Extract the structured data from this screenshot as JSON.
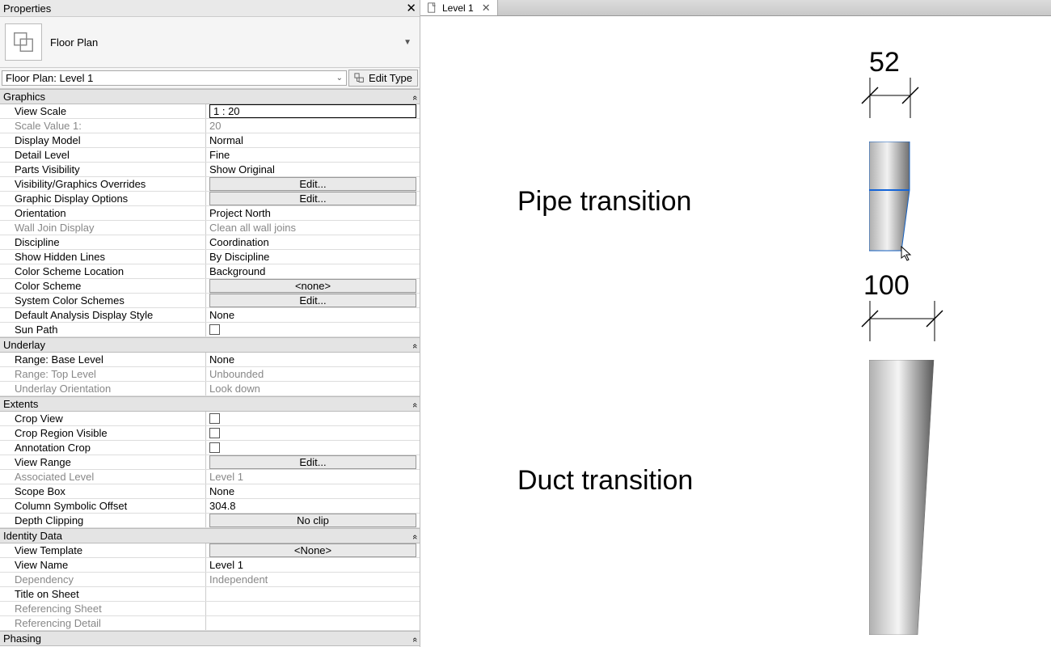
{
  "panel": {
    "title": "Properties",
    "close": "✕",
    "type_name": "Floor Plan",
    "instance_name": "Floor Plan: Level 1",
    "edit_type": "Edit Type"
  },
  "groups": [
    {
      "name": "Graphics",
      "rows": [
        {
          "n": "View Scale",
          "v": "1 : 20",
          "kind": "boxed"
        },
        {
          "n": "Scale Value    1:",
          "v": "20",
          "disabled": true
        },
        {
          "n": "Display Model",
          "v": "Normal"
        },
        {
          "n": "Detail Level",
          "v": "Fine"
        },
        {
          "n": "Parts Visibility",
          "v": "Show Original"
        },
        {
          "n": "Visibility/Graphics Overrides",
          "v": "Edit...",
          "kind": "btn"
        },
        {
          "n": "Graphic Display Options",
          "v": "Edit...",
          "kind": "btn"
        },
        {
          "n": "Orientation",
          "v": "Project North"
        },
        {
          "n": "Wall Join Display",
          "v": "Clean all wall joins",
          "disabled": true
        },
        {
          "n": "Discipline",
          "v": "Coordination"
        },
        {
          "n": "Show Hidden Lines",
          "v": "By Discipline"
        },
        {
          "n": "Color Scheme Location",
          "v": "Background"
        },
        {
          "n": "Color Scheme",
          "v": "<none>",
          "kind": "btn"
        },
        {
          "n": "System Color Schemes",
          "v": "Edit...",
          "kind": "btn"
        },
        {
          "n": "Default Analysis Display Style",
          "v": "None"
        },
        {
          "n": "Sun Path",
          "v": "",
          "kind": "check"
        }
      ]
    },
    {
      "name": "Underlay",
      "rows": [
        {
          "n": "Range: Base Level",
          "v": "None"
        },
        {
          "n": "Range: Top Level",
          "v": "Unbounded",
          "disabled": true
        },
        {
          "n": "Underlay Orientation",
          "v": "Look down",
          "disabled": true
        }
      ]
    },
    {
      "name": "Extents",
      "rows": [
        {
          "n": "Crop View",
          "v": "",
          "kind": "check"
        },
        {
          "n": "Crop Region Visible",
          "v": "",
          "kind": "check"
        },
        {
          "n": "Annotation Crop",
          "v": "",
          "kind": "check"
        },
        {
          "n": "View Range",
          "v": "Edit...",
          "kind": "btn"
        },
        {
          "n": "Associated Level",
          "v": "Level 1",
          "disabled": true
        },
        {
          "n": "Scope Box",
          "v": "None"
        },
        {
          "n": "Column Symbolic Offset",
          "v": "304.8"
        },
        {
          "n": "Depth Clipping",
          "v": "No clip",
          "kind": "btn"
        }
      ]
    },
    {
      "name": "Identity Data",
      "rows": [
        {
          "n": "View Template",
          "v": "<None>",
          "kind": "btn"
        },
        {
          "n": "View Name",
          "v": "Level 1"
        },
        {
          "n": "Dependency",
          "v": "Independent",
          "disabled": true
        },
        {
          "n": "Title on Sheet",
          "v": ""
        },
        {
          "n": "Referencing Sheet",
          "v": "",
          "disabled": true
        },
        {
          "n": "Referencing Detail",
          "v": "",
          "disabled": true
        }
      ]
    },
    {
      "name": "Phasing",
      "rows": []
    }
  ],
  "tab": {
    "label": "Level 1"
  },
  "canvas": {
    "label_pipe": "Pipe transition",
    "label_duct": "Duct transition",
    "dim_pipe": "52",
    "dim_duct": "100"
  }
}
